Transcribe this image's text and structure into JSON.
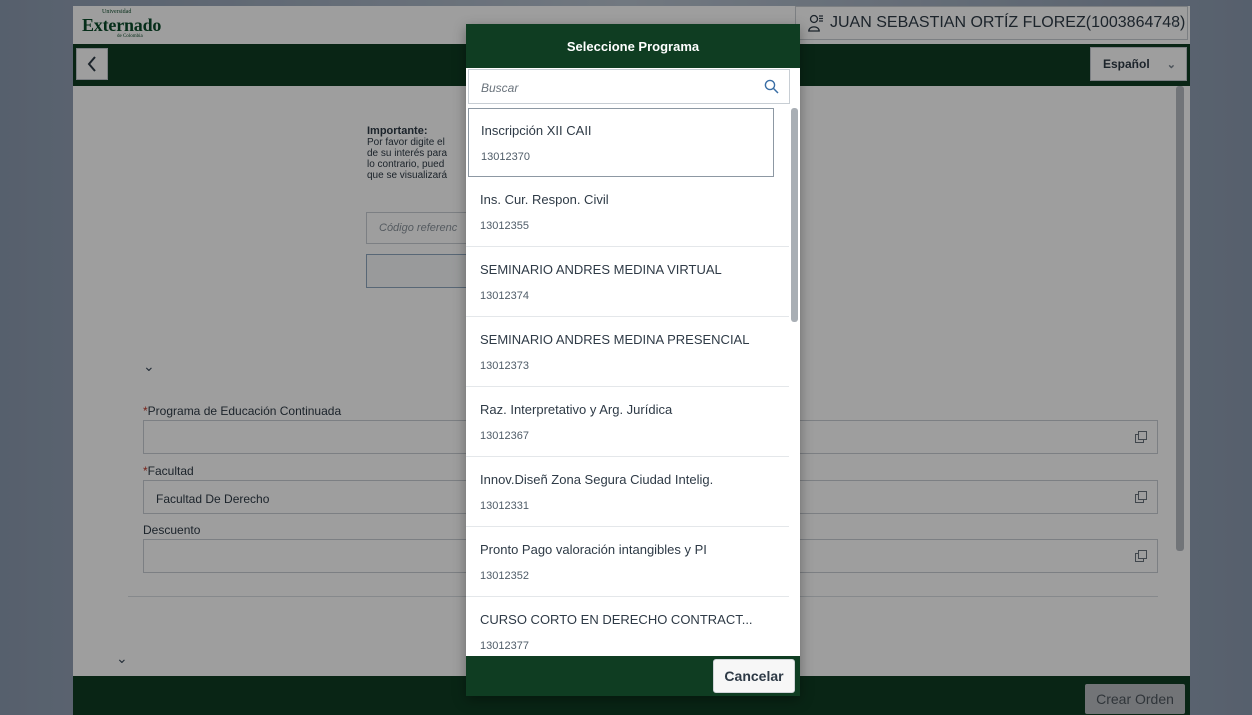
{
  "header": {
    "logo_small": "Universidad",
    "logo_main": "Externado",
    "logo_sub": "de Colombia",
    "user_label": "JUAN SEBASTIAN ORTÍZ FLOREZ(1003864748)"
  },
  "navbar": {
    "language": "Español"
  },
  "form": {
    "important_title": "Importante:",
    "important_lines": [
      "Por favor digite el",
      "de su interés para",
      "lo contrario, pued",
      "que se visualizará"
    ],
    "reference_placeholder": "Código referenc",
    "programa_label": "Programa de Educación Continuada",
    "programa_value": "",
    "facultad_label": "Facultad",
    "facultad_value": "Facultad De Derecho",
    "descuento_label": "Descuento",
    "descuento_value": "",
    "required_mark": "*"
  },
  "footer": {
    "crear_orden": "Crear Orden"
  },
  "dialog": {
    "title": "Seleccione Programa",
    "search_placeholder": "Buscar",
    "cancel": "Cancelar",
    "items": [
      {
        "title": "Inscripción XII CAII",
        "code": "13012370"
      },
      {
        "title": "Ins. Cur. Respon. Civil",
        "code": "13012355"
      },
      {
        "title": "SEMINARIO ANDRES MEDINA VIRTUAL",
        "code": "13012374"
      },
      {
        "title": "SEMINARIO ANDRES MEDINA PRESENCIAL",
        "code": "13012373"
      },
      {
        "title": "Raz. Interpretativo y Arg. Jurídica",
        "code": "13012367"
      },
      {
        "title": "Innov.Diseñ Zona Segura Ciudad Intelig.",
        "code": "13012331"
      },
      {
        "title": "Pronto Pago valoración intangibles y PI",
        "code": "13012352"
      },
      {
        "title": "CURSO CORTO EN DERECHO CONTRACT...",
        "code": "13012377"
      }
    ]
  },
  "colors": {
    "brand_green": "#0f3d22"
  }
}
